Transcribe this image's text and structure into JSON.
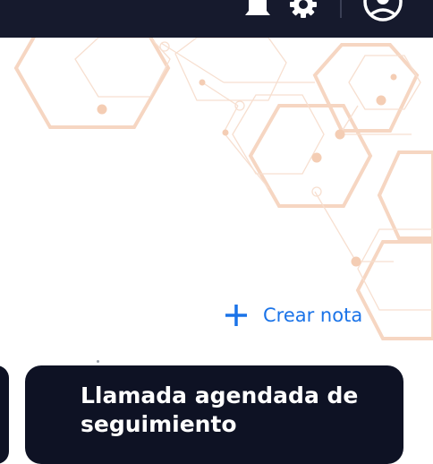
{
  "header": {
    "icons": [
      "bell-icon",
      "gear-icon",
      "user-avatar-icon"
    ]
  },
  "actions": {
    "create_note_label": "Crear nota",
    "create_note_icon": "plus-icon"
  },
  "cards": [
    {
      "title": "Llamada agendada de seguimiento"
    }
  ],
  "colors": {
    "topbar": "#161a2d",
    "accent": "#1a73e8",
    "card_bg": "#0e1224",
    "pattern": "#f6d6c2"
  }
}
